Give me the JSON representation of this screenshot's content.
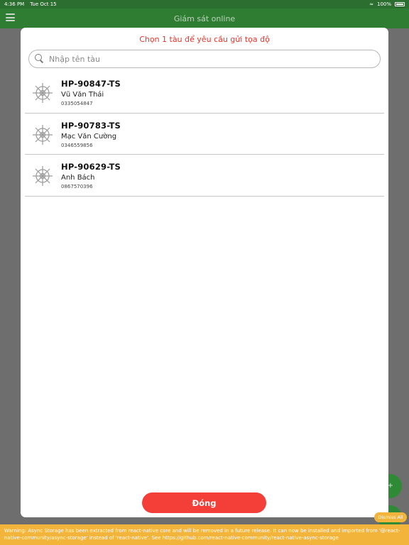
{
  "status_bar": {
    "time": "4:36 PM",
    "date": "Tue Oct 15",
    "battery": "100%"
  },
  "header": {
    "title": "Giám sát online"
  },
  "modal": {
    "title": "Chọn 1 tàu để yêu cầu gửi tọa độ",
    "search_placeholder": "Nhập tên tàu",
    "ships": [
      {
        "code": "HP-90847-TS",
        "owner": "Vũ Văn Thái",
        "phone": "0335054847"
      },
      {
        "code": "HP-90783-TS",
        "owner": "Mạc Văn Cường",
        "phone": "0346559856"
      },
      {
        "code": "HP-90629-TS",
        "owner": "Anh Bách",
        "phone": "0867570396"
      }
    ],
    "close_label": "Đóng"
  },
  "warning": {
    "dismiss_label": "Dismiss All",
    "text": "Warning: Async Storage has been extracted from react-native core and will be removed in a future release. It can now be installed and imported from '@react-native-community/async-storage' instead of 'react-native'. See https://github.com/react-native-community/react-native-async-storage"
  },
  "colors": {
    "header_green": "#2f7d32",
    "accent_red": "#f33f37",
    "warning_yellow": "#f2b43a"
  },
  "icons": {
    "ship": "ship-wheel-icon",
    "search": "search-icon",
    "menu": "menu-icon"
  }
}
